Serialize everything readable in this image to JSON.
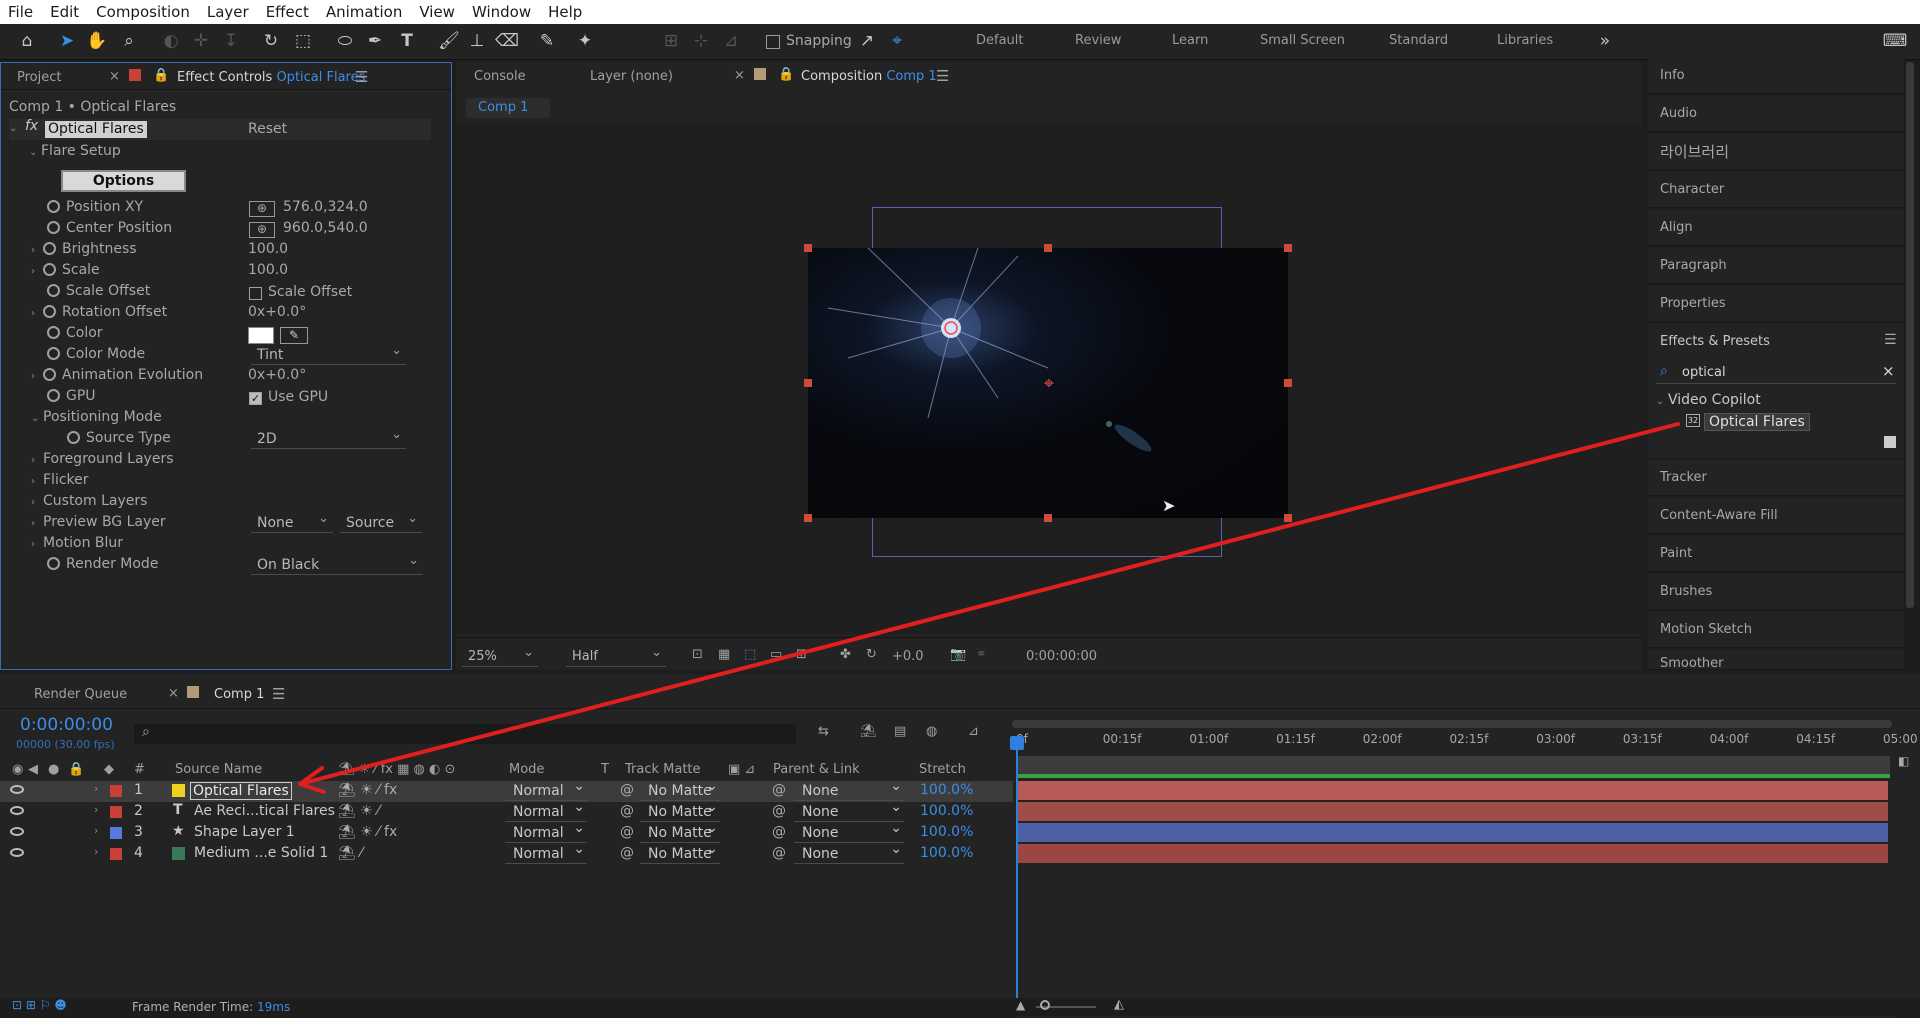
{
  "menu": [
    "File",
    "Edit",
    "Composition",
    "Layer",
    "Effect",
    "Animation",
    "View",
    "Window",
    "Help"
  ],
  "toolbar": {
    "snapping": "Snapping",
    "workspaces": [
      "Default",
      "Review",
      "Learn",
      "Small Screen",
      "Standard",
      "Libraries"
    ]
  },
  "left_panel": {
    "tab_project": "Project",
    "tab_effect": "Effect Controls",
    "tab_effect_target": "Optical Flares",
    "breadcrumb": "Comp 1 • Optical Flares",
    "effect_name": "Optical Flares",
    "reset": "Reset",
    "flare_setup": "Flare Setup",
    "options": "Options",
    "props": [
      {
        "label": "Position XY",
        "value": "576.0,324.0"
      },
      {
        "label": "Center Position",
        "value": "960.0,540.0"
      },
      {
        "label": "Brightness",
        "value": "100.0"
      },
      {
        "label": "Scale",
        "value": "100.0"
      },
      {
        "label": "Scale Offset",
        "value": "Scale Offset"
      },
      {
        "label": "Rotation Offset",
        "value": "0x+0.0°"
      },
      {
        "label": "Color",
        "value": ""
      },
      {
        "label": "Color Mode",
        "value": "Tint"
      },
      {
        "label": "Animation Evolution",
        "value": "0x+0.0°"
      },
      {
        "label": "GPU",
        "value": "Use GPU"
      }
    ],
    "positioning_mode": "Positioning Mode",
    "source_type": "Source Type",
    "source_type_value": "2D",
    "foreground_layers": "Foreground Layers",
    "flicker": "Flicker",
    "custom_layers": "Custom Layers",
    "preview_bg": "Preview BG Layer",
    "preview_bg_a": "None",
    "preview_bg_b": "Source",
    "motion_blur": "Motion Blur",
    "render_mode": "Render Mode",
    "render_mode_value": "On Black"
  },
  "center": {
    "tab_console": "Console",
    "tab_layer": "Layer (none)",
    "tab_comp": "Composition",
    "tab_comp_name": "Comp 1",
    "comp_pill": "Comp 1",
    "zoom": "25%",
    "resolution": "Half",
    "exposure": "+0.0",
    "timecode": "0:00:00:00"
  },
  "right_panel": {
    "items_top": [
      "Info",
      "Audio",
      "라이브러리",
      "Character",
      "Align",
      "Paragraph",
      "Properties"
    ],
    "effects_presets": "Effects & Presets",
    "search_value": "optical",
    "folder": "Video Copilot",
    "effect_item": "Optical Flares",
    "items_bottom": [
      "Tracker",
      "Content-Aware Fill",
      "Paint",
      "Brushes",
      "Motion Sketch",
      "Smoother"
    ]
  },
  "timeline": {
    "tab_render": "Render Queue",
    "tab_comp": "Comp 1",
    "timecode": "0:00:00:00",
    "frames": "00000 (30.00 fps)",
    "headers": {
      "num": "#",
      "source": "Source Name",
      "mode": "Mode",
      "t": "T",
      "matte": "Track Matte",
      "parent": "Parent & Link",
      "stretch": "Stretch"
    },
    "ruler": [
      "0f",
      "00:15f",
      "01:00f",
      "01:15f",
      "02:00f",
      "02:15f",
      "03:00f",
      "03:15f",
      "04:00f",
      "04:15f",
      "05:00"
    ],
    "layers": [
      {
        "num": "1",
        "name": "Optical Flares",
        "mode": "Normal",
        "matte": "No Matte",
        "parent": "None",
        "stretch": "100.0%",
        "label_color": "#f0d020",
        "bar_color": "#b85a55"
      },
      {
        "num": "2",
        "name": "Ae Reci...tical Flares",
        "mode": "Normal",
        "matte": "No Matte",
        "parent": "None",
        "stretch": "100.0%",
        "label_color": "#c94038",
        "bar_color": "#a04c49"
      },
      {
        "num": "3",
        "name": "Shape Layer 1",
        "mode": "Normal",
        "matte": "No Matte",
        "parent": "None",
        "stretch": "100.0%",
        "label_color": "#5a76e0",
        "bar_color": "#4d60a6"
      },
      {
        "num": "4",
        "name": "Medium ...e Solid 1",
        "mode": "Normal",
        "matte": "No Matte",
        "parent": "None",
        "stretch": "100.0%",
        "label_color": "#c94038",
        "bar_color": "#9a4644"
      }
    ],
    "status_label": "Frame Render Time:",
    "status_value": "19ms"
  }
}
